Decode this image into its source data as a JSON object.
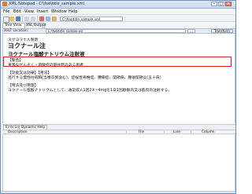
{
  "window": {
    "title": "XML Notepad - C:\\foo\\title_sample.xml",
    "minimize": "–",
    "maximize": "□",
    "close": "×"
  },
  "menu": [
    "File",
    "Edit",
    "View",
    "Insert",
    "Window",
    "Help"
  ],
  "toolbar": {
    "file_combo_value": "C:\\foo\\title_sample.xml"
  },
  "tabs": {
    "document": "Tree View",
    "xsl_output": "XSL Output"
  },
  "xslt": {
    "label": "XSLT Location:",
    "input_value": "C:\\foo\\title_sample.xsl",
    "browse": "...",
    "transform": "Transform"
  },
  "content": {
    "maker": "ヌグヨヲナル製剤",
    "drug_name": "ヨクナール注",
    "generic_name": "ヨクナール塩酸ナトリウム注射液",
    "warning_heading": "【警告】",
    "warning_text": "重篤なぜんぞく・過敏症の既往歴のある患者",
    "indications_heading": "【効能又は効果】【用法】",
    "indications_text": "進行する慢性柱病胸(当番卒倒含む)、症候性脊椎症、腰痛症、関節痛、腫瘍関節炎(五十肩)",
    "dosage_heading": "【用法及び用量】",
    "dosage_text": "ヨクナール塩酸ナトリウムとして、通常成人1回2※~4mgを1日1回静脈内又は筋肉内注射する。"
  },
  "bottom_panel": {
    "tabs": [
      "Error List",
      "Dynamic Help"
    ],
    "columns": [
      "Description",
      "File",
      "Line",
      "Column"
    ]
  },
  "colors": {
    "highlight_border": "#d2232a"
  }
}
